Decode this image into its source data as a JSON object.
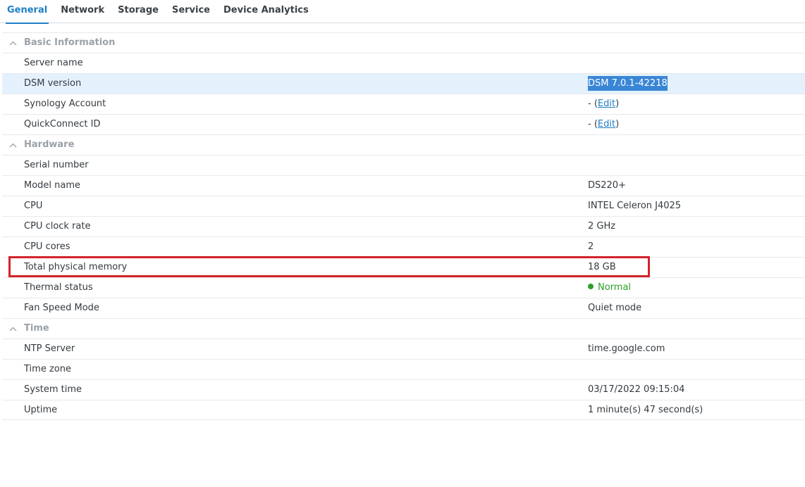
{
  "tabs": [
    {
      "label": "General",
      "active": true
    },
    {
      "label": "Network"
    },
    {
      "label": "Storage"
    },
    {
      "label": "Service"
    },
    {
      "label": "Device Analytics"
    }
  ],
  "sections": {
    "basic": {
      "title": "Basic Information",
      "rows": {
        "server_name": {
          "label": "Server name",
          "value": ""
        },
        "dsm_version": {
          "label": "DSM version",
          "value": "DSM 7.0.1-42218"
        },
        "synology_account": {
          "label": "Synology Account",
          "prefix": "- (",
          "link": "Edit",
          "suffix": ")"
        },
        "quickconnect_id": {
          "label": "QuickConnect ID",
          "prefix": "- (",
          "link": "Edit",
          "suffix": ")"
        }
      }
    },
    "hardware": {
      "title": "Hardware",
      "rows": {
        "serial_number": {
          "label": "Serial number",
          "value": ""
        },
        "model_name": {
          "label": "Model name",
          "value": "DS220+"
        },
        "cpu": {
          "label": "CPU",
          "value": "INTEL Celeron J4025"
        },
        "cpu_clock": {
          "label": "CPU clock rate",
          "value": "2 GHz"
        },
        "cpu_cores": {
          "label": "CPU cores",
          "value": "2"
        },
        "memory": {
          "label": "Total physical memory",
          "value": "18 GB"
        },
        "thermal": {
          "label": "Thermal status",
          "value": "Normal",
          "status_color": "#2aa02a"
        },
        "fan": {
          "label": "Fan Speed Mode",
          "value": "Quiet mode"
        }
      }
    },
    "time": {
      "title": "Time",
      "rows": {
        "ntp": {
          "label": "NTP Server",
          "value": "time.google.com"
        },
        "timezone": {
          "label": "Time zone",
          "value": ""
        },
        "system_time": {
          "label": "System time",
          "value": "03/17/2022 09:15:04"
        },
        "uptime": {
          "label": "Uptime",
          "value": "1 minute(s) 47 second(s)"
        }
      }
    }
  },
  "colors": {
    "accent": "#1f7fc5",
    "selection": "#3a86d6",
    "selected_row": "#e4f1fd",
    "status_ok": "#2aa02a",
    "highlight_box": "#d3232b"
  },
  "icons": {
    "section_toggle": "chevron-up-icon",
    "status": "status-dot-icon"
  }
}
